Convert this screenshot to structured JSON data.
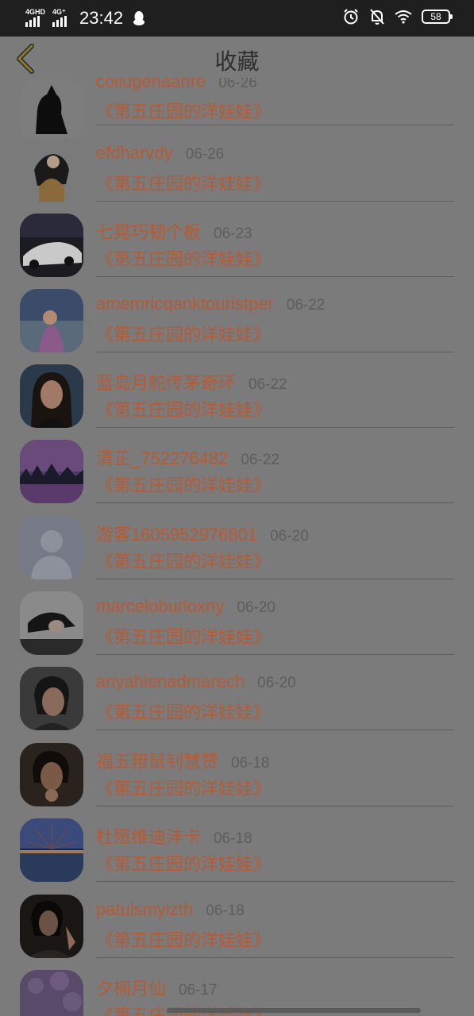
{
  "status_bar": {
    "net1": "4GHD",
    "net2": "4G⁺",
    "time": "23:42",
    "battery": "58"
  },
  "header": {
    "title": "收藏"
  },
  "items": [
    {
      "username": "collugenaanre",
      "date": "06-26",
      "book": "《第五庄园的洋娃娃》"
    },
    {
      "username": "efdharvdy",
      "date": "06-26",
      "book": "《第五庄园的洋娃娃》"
    },
    {
      "username": "七晃巧韧个板",
      "date": "06-23",
      "book": "《第五庄园的洋娃娃》"
    },
    {
      "username": "amemricqanktouristper",
      "date": "06-22",
      "book": "《第五庄园的洋娃娃》"
    },
    {
      "username": "蓝岛月舵传茅奇环",
      "date": "06-22",
      "book": "《第五庄园的洋娃娃》"
    },
    {
      "username": "清芷_752276482",
      "date": "06-22",
      "book": "《第五庄园的洋娃娃》"
    },
    {
      "username": "游客1605952976801",
      "date": "06-20",
      "book": "《第五庄园的洋娃娃》"
    },
    {
      "username": "marceloburloxny",
      "date": "06-20",
      "book": "《第五庄园的洋娃娃》"
    },
    {
      "username": "anyahienadmarech",
      "date": "06-20",
      "book": "《第五庄园的洋娃娃》"
    },
    {
      "username": "福五箝鼠钊慧赞",
      "date": "06-18",
      "book": "《第五庄园的洋娃娃》"
    },
    {
      "username": "杜殖维迪沣卡",
      "date": "06-18",
      "book": "《第五庄园的洋娃娃》"
    },
    {
      "username": "patulsmyizth",
      "date": "06-18",
      "book": "《第五庄园的洋娃娃》"
    },
    {
      "username": "夕楠月仙",
      "date": "06-17",
      "book": "《第五庄园的洋娃娃》"
    }
  ]
}
